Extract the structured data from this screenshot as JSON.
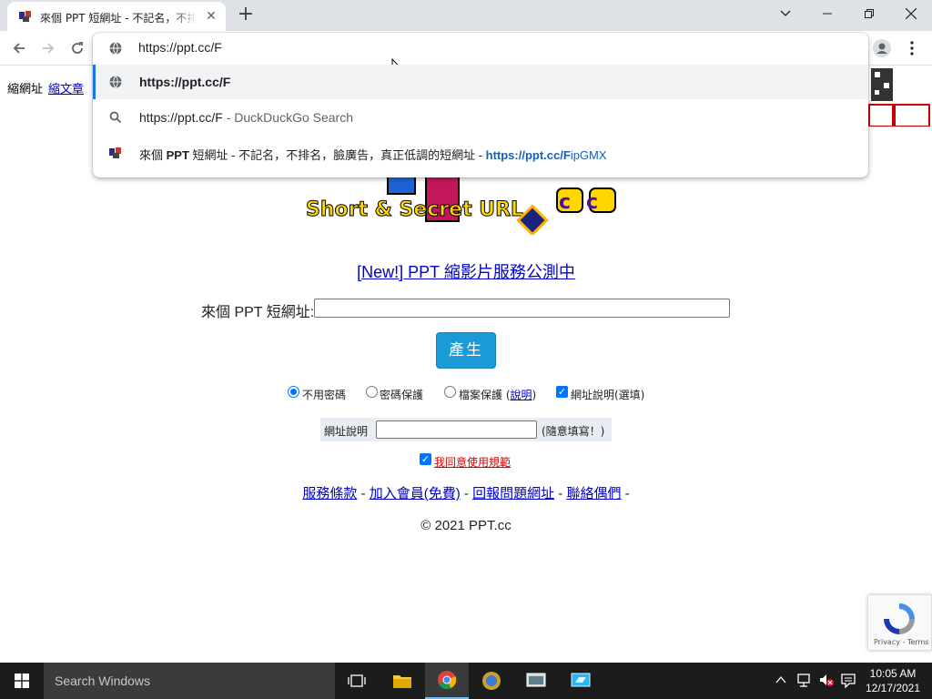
{
  "browser": {
    "tab_title": "來個 PPT 短網址 - 不記名，不排名，",
    "tab_close": "✕",
    "new_tab": "+",
    "window_controls": {
      "minimize": "—",
      "maximize": "❐",
      "close": "✕",
      "tab_search": "⌄"
    }
  },
  "omnibox": {
    "input_value": "https://ppt.cc/F",
    "suggestions": [
      {
        "icon": "globe-icon",
        "text": "https://ppt.cc/F",
        "selected": true
      },
      {
        "icon": "search-icon",
        "text": "https://ppt.cc/F",
        "suffix": " - DuckDuckGo Search"
      },
      {
        "icon": "site-favicon",
        "title_pre": "來個 ",
        "title_bold": "PPT",
        "title_post": " 短網址 - 不記名，不排名，臉廣告，真正低調的短網址 - ",
        "url_bold": "https://ppt.cc/F",
        "url_rest": "ipGMX"
      }
    ]
  },
  "page": {
    "nav_text": "縮網址",
    "nav_link": "縮文章",
    "logo_text": "Short & Secret URL",
    "logo_cc": "cc",
    "new_link": "[New!] PPT 縮影片服務公測中",
    "url_label": "來個 PPT 短網址:",
    "generate_button": "產生",
    "options": [
      {
        "label": "不用密碼",
        "checked": true
      },
      {
        "label": "密碼保護",
        "checked": false
      },
      {
        "label": "檔案保護 (",
        "link": "說明",
        "tail": ")",
        "checked": false
      }
    ],
    "url_desc_option": "網址說明(選填)",
    "desc_label": "網址說明",
    "desc_hint": "(隨意填寫！)",
    "agree_label": "我同意使用規範",
    "footer_links": [
      "服務條款",
      "加入會員(免費)",
      "回報問題網址",
      "聯絡偶們"
    ],
    "footer_sep": " - ",
    "copyright": "© 2021 PPT.cc",
    "recaptcha": "Privacy - Terms"
  },
  "taskbar": {
    "search_placeholder": "Search Windows",
    "time": "10:05 AM",
    "date": "12/17/2021"
  },
  "colors": {
    "accent_blue": "#1a9bd7",
    "link": "#0000cc",
    "omnibox_url": "#1a5fb4",
    "taskbar": "#1c1c1c"
  }
}
